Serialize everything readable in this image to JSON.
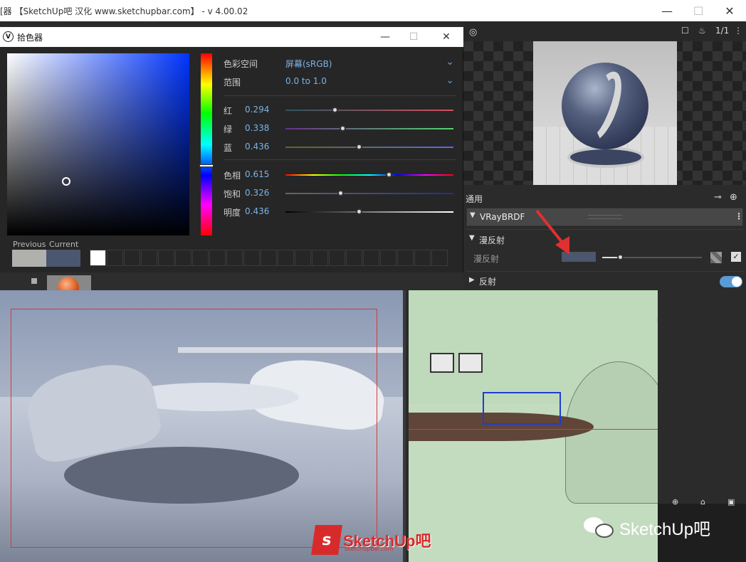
{
  "app": {
    "title": "[器 【SketchUp吧 汉化 www.sketchupbar.com】 - v 4.00.02",
    "minimize": "—",
    "maximize": "☐",
    "close": "✕"
  },
  "picker": {
    "title": "拾色器",
    "logo": "V",
    "minimize": "—",
    "maximize": "☐",
    "close": "✕",
    "color_space_label": "色彩空间",
    "color_space_value": "屏幕(sRGB)",
    "range_label": "范围",
    "range_value": "0.0 to 1.0",
    "sliders": [
      {
        "label": "红",
        "value": "0.294",
        "fraction": 0.294
      },
      {
        "label": "绿",
        "value": "0.338",
        "fraction": 0.338
      },
      {
        "label": "蓝",
        "value": "0.436",
        "fraction": 0.436
      },
      {
        "label": "色相",
        "value": "0.615",
        "fraction": 0.615
      },
      {
        "label": "饱和",
        "value": "0.326",
        "fraction": 0.326
      },
      {
        "label": "明度",
        "value": "0.436",
        "fraction": 0.436
      }
    ],
    "previous_label": "Previous",
    "current_label": "Current",
    "previous_color": "#b0b0ac",
    "current_color": "#4b5670"
  },
  "preview": {
    "ratio_label": "1/1"
  },
  "material": {
    "section": "通用",
    "brdf": "VRayBRDF",
    "diffuse_section": "漫反射",
    "diffuse_label": "漫反射",
    "diffuse_color": "#4b5670",
    "reflection_section": "反射"
  },
  "watermarks": {
    "logo_text": "SketchUp吧",
    "logo_sub": "sketchupbar.com",
    "wechat_text": "SketchUp吧"
  }
}
